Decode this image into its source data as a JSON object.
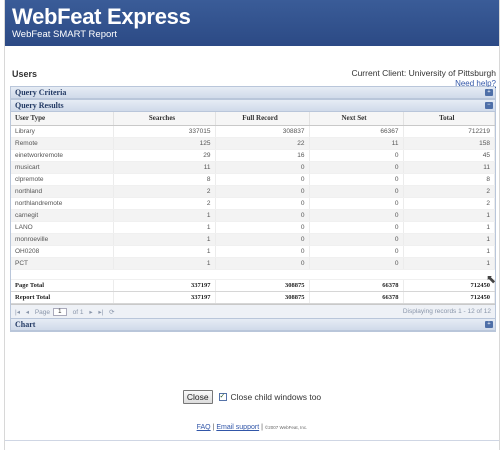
{
  "header": {
    "title": "WebFeat Express",
    "subtitle": "WebFeat SMART Report"
  },
  "page": {
    "section_label": "Users",
    "client_text": "Current Client: University of Pittsburgh",
    "help_link": "Need help?"
  },
  "query_criteria": {
    "title": "Query Criteria",
    "toggle": "+"
  },
  "query_results": {
    "title": "Query Results",
    "toggle": "−",
    "columns": [
      "User Type",
      "Searches",
      "Full Record",
      "Next Set",
      "Total"
    ],
    "rows": [
      [
        "Library",
        "337015",
        "308837",
        "66367",
        "712219"
      ],
      [
        "Remote",
        "125",
        "22",
        "11",
        "158"
      ],
      [
        "einetworkremote",
        "29",
        "16",
        "0",
        "45"
      ],
      [
        "musicart",
        "11",
        "0",
        "0",
        "11"
      ],
      [
        "clpremote",
        "8",
        "0",
        "0",
        "8"
      ],
      [
        "northland",
        "2",
        "0",
        "0",
        "2"
      ],
      [
        "northlandremote",
        "2",
        "0",
        "0",
        "2"
      ],
      [
        "carnegit",
        "1",
        "0",
        "0",
        "1"
      ],
      [
        "LANO",
        "1",
        "0",
        "0",
        "1"
      ],
      [
        "monroeville",
        "1",
        "0",
        "0",
        "1"
      ],
      [
        "OH0208",
        "1",
        "0",
        "0",
        "1"
      ],
      [
        "PCT",
        "1",
        "0",
        "0",
        "1"
      ]
    ],
    "page_total": [
      "Page Total",
      "337197",
      "308875",
      "66378",
      "712450"
    ],
    "report_total": [
      "Report Total",
      "337197",
      "308875",
      "66378",
      "712450"
    ]
  },
  "pager": {
    "first": "|◂",
    "prev": "◂",
    "page_label": "Page",
    "page_value": "1",
    "of_label": "of 1",
    "next": "▸",
    "last": "▸|",
    "refresh": "⟳",
    "display_text": "Displaying records 1 - 12 of 12"
  },
  "chart_panel": {
    "title": "Chart",
    "toggle": "+"
  },
  "actions": {
    "close_label": "Close",
    "close_children_label": "Close child windows too"
  },
  "footer": {
    "faq": "FAQ",
    "separator1": "|",
    "email_support": "Email support",
    "separator2": "|",
    "copyright": "©2007 WebFeat, Inc."
  }
}
